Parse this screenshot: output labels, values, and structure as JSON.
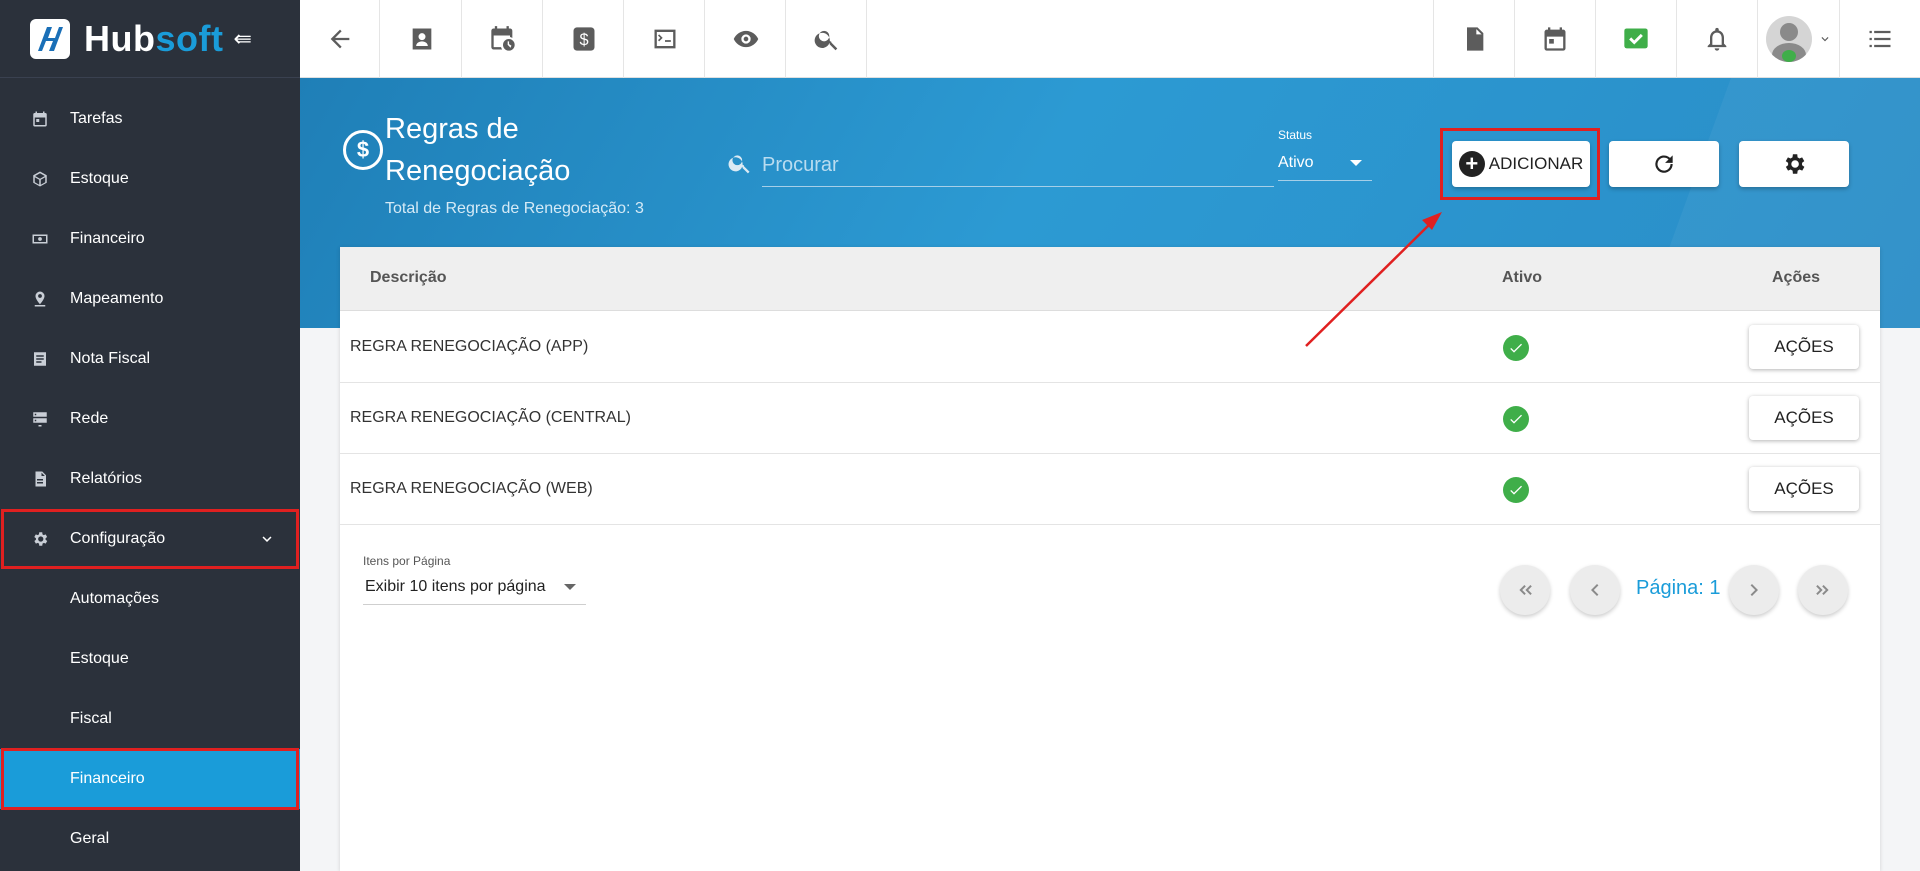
{
  "brand": {
    "name_part1": "Hub",
    "name_part2": "soft"
  },
  "sidebar": {
    "items": [
      {
        "label": "Tarefas",
        "icon": "calendar-icon"
      },
      {
        "label": "Estoque",
        "icon": "box-icon"
      },
      {
        "label": "Financeiro",
        "icon": "money-icon"
      },
      {
        "label": "Mapeamento",
        "icon": "map-pin-icon"
      },
      {
        "label": "Nota Fiscal",
        "icon": "document-icon"
      },
      {
        "label": "Rede",
        "icon": "server-icon"
      },
      {
        "label": "Relatórios",
        "icon": "report-icon"
      },
      {
        "label": "Configuração",
        "icon": "gear-icon"
      }
    ],
    "subitems": [
      {
        "label": "Automações"
      },
      {
        "label": "Estoque"
      },
      {
        "label": "Fiscal"
      },
      {
        "label": "Financeiro"
      },
      {
        "label": "Geral"
      }
    ]
  },
  "header": {
    "title": "Regras de Renegociação",
    "subtitle": "Total de Regras de Renegociação: 3",
    "search_placeholder": "Procurar",
    "status_label": "Status",
    "status_value": "Ativo",
    "add_label": "ADICIONAR"
  },
  "table": {
    "columns": {
      "description": "Descrição",
      "active": "Ativo",
      "actions": "Ações"
    },
    "rows": [
      {
        "description": "REGRA RENEGOCIAÇÃO (APP)",
        "active": true,
        "action_label": "AÇÕES"
      },
      {
        "description": "REGRA RENEGOCIAÇÃO (CENTRAL)",
        "active": true,
        "action_label": "AÇÕES"
      },
      {
        "description": "REGRA RENEGOCIAÇÃO (WEB)",
        "active": true,
        "action_label": "AÇÕES"
      }
    ]
  },
  "pagination": {
    "items_per_page_label": "Itens por Página",
    "items_per_page_value": "Exibir 10 itens por página",
    "page_label": "Página: 1"
  },
  "colors": {
    "sidebar_bg": "#2b313b",
    "accent": "#1a9cd9",
    "band": "#2c9ad3",
    "success": "#3fae49",
    "highlight": "#e02020"
  }
}
